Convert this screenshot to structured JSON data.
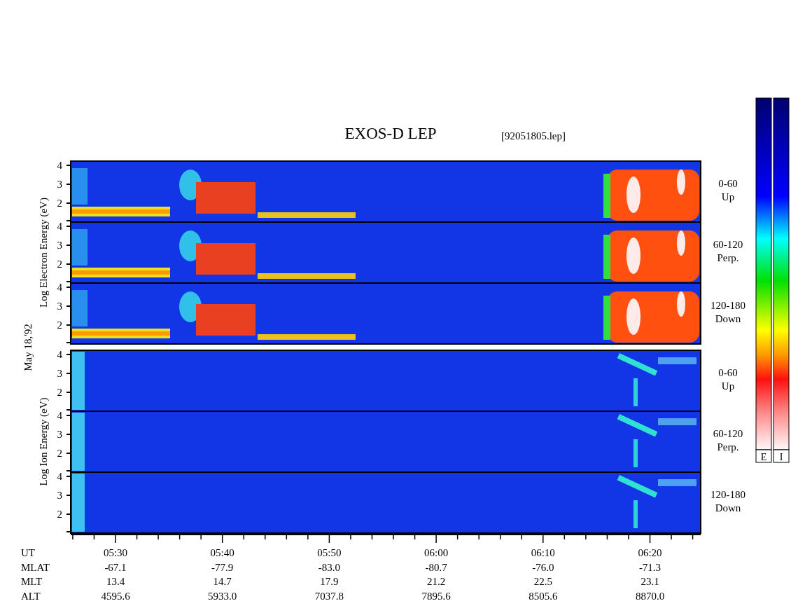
{
  "title": "EXOS-D LEP",
  "file_label": "[92051805.lep]",
  "date_label": "May 18,'92",
  "groups": [
    {
      "kind": "electron",
      "axis_label": "Log  Electron  Energy (eV)",
      "panels": [
        {
          "yticks": [
            "4",
            "3",
            "2"
          ],
          "angle": "0-60",
          "direction": "Up"
        },
        {
          "yticks": [
            "4",
            "3",
            "2"
          ],
          "angle": "60-120",
          "direction": "Perp."
        },
        {
          "yticks": [
            "4",
            "3",
            "2"
          ],
          "angle": "120-180",
          "direction": "Down"
        }
      ]
    },
    {
      "kind": "ion",
      "axis_label": "Log  Ion  Energy (eV)",
      "panels": [
        {
          "yticks": [
            "4",
            "3",
            "2"
          ],
          "angle": "0-60",
          "direction": "Up"
        },
        {
          "yticks": [
            "4",
            "3",
            "2"
          ],
          "angle": "60-120",
          "direction": "Perp."
        },
        {
          "yticks": [
            "4",
            "3",
            "2"
          ],
          "angle": "120-180",
          "direction": "Down"
        }
      ]
    }
  ],
  "colorbars": [
    {
      "label": "E"
    },
    {
      "label": "I"
    }
  ],
  "x_rows": [
    {
      "label": "UT",
      "values": [
        "05:30",
        "05:40",
        "05:50",
        "06:00",
        "06:10",
        "06:20"
      ]
    },
    {
      "label": "MLAT",
      "values": [
        "-67.1",
        "-77.9",
        "-83.0",
        "-80.7",
        "-76.0",
        "-71.3"
      ]
    },
    {
      "label": "MLT",
      "values": [
        "13.4",
        "14.7",
        "17.9",
        "21.2",
        "22.5",
        "23.1"
      ]
    },
    {
      "label": "ALT",
      "values": [
        "4595.6",
        "5933.0",
        "7037.8",
        "7895.6",
        "8505.6",
        "8870.0"
      ]
    }
  ]
}
